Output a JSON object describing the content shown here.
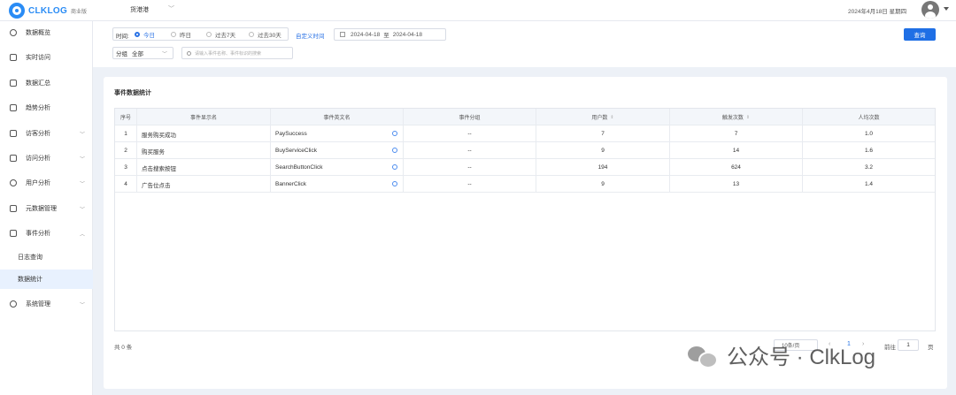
{
  "app": {
    "logo_text": "CLKLOG",
    "edition": "商业版",
    "project": "货港港",
    "current_date": "2024年4月18日 星期四"
  },
  "sidebar": {
    "items": [
      {
        "label": "数据概览",
        "icon": "dashboard-icon"
      },
      {
        "label": "实时访问",
        "icon": "realtime-icon"
      },
      {
        "label": "数据汇总",
        "icon": "summary-icon"
      },
      {
        "label": "趋势分析",
        "icon": "trend-icon"
      },
      {
        "label": "访客分析",
        "icon": "visitor-icon"
      },
      {
        "label": "访问分析",
        "icon": "visit-icon"
      },
      {
        "label": "用户分析",
        "icon": "user-icon"
      },
      {
        "label": "元数据管理",
        "icon": "metadata-icon"
      },
      {
        "label": "事件分析",
        "icon": "event-icon"
      },
      {
        "label": "系统管理",
        "icon": "settings-icon"
      }
    ],
    "sub_items": [
      {
        "label": "日志查询"
      },
      {
        "label": "数据统计"
      }
    ]
  },
  "filters": {
    "time_label": "时间:",
    "time_options": [
      "今日",
      "昨日",
      "过去7天",
      "过去30天"
    ],
    "selected_time": "今日",
    "custom_label": "自定义时间",
    "date_start": "2024-04-18",
    "date_sep": "至",
    "date_end": "2024-04-18",
    "query_label": "查询",
    "group_label": "分组",
    "group_value": "全部",
    "search_placeholder": "请输入事件名称、事件标识的搜索"
  },
  "card": {
    "title": "事件数据统计"
  },
  "table": {
    "headers": [
      "序号",
      "事件显示名",
      "事件英文名",
      "事件分组",
      "用户数",
      "触发次数",
      "人均次数"
    ],
    "rows": [
      {
        "idx": "1",
        "display": "服务购买成功",
        "en": "PaySuccess",
        "group": "--",
        "users": "7",
        "triggers": "7",
        "avg": "1.0"
      },
      {
        "idx": "2",
        "display": "购买服务",
        "en": "BuyServiceClick",
        "group": "--",
        "users": "9",
        "triggers": "14",
        "avg": "1.6"
      },
      {
        "idx": "3",
        "display": "点击搜索按钮",
        "en": "SearchButtonClick",
        "group": "--",
        "users": "194",
        "triggers": "624",
        "avg": "3.2"
      },
      {
        "idx": "4",
        "display": "广告位点击",
        "en": "BannerClick",
        "group": "--",
        "users": "9",
        "triggers": "13",
        "avg": "1.4"
      }
    ]
  },
  "pagination": {
    "total": "共 0 条",
    "page_size": "10条/页",
    "current_page": "1",
    "goto_label": "前往",
    "goto_value": "1",
    "goto_unit": "页"
  },
  "watermark": {
    "text": "公众号 · ClkLog"
  }
}
